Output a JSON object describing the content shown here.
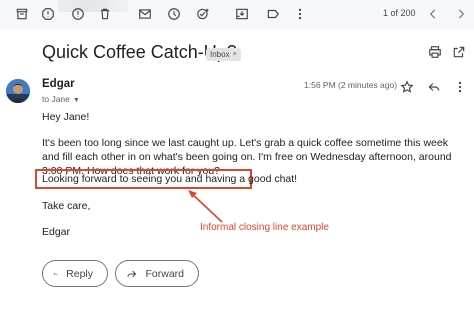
{
  "toolbar": {
    "counter": "1 of 200",
    "icons": [
      "archive-icon",
      "report-spam-icon",
      "delete-icon",
      "mark-unread-icon",
      "snooze-icon",
      "add-task-icon",
      "move-to-icon",
      "label-icon",
      "more-vert-icon",
      "newer-icon",
      "older-icon"
    ]
  },
  "email": {
    "subject": "Quick Coffee Catch-Up?",
    "label_badge": "Inbox",
    "label_remove": "×",
    "sender": "Edgar",
    "to_line": "to Jane",
    "timestamp": "1:56 PM (2 minutes ago)",
    "greeting": "Hey Jane!",
    "paragraph": "It's been too long since we last caught up. Let's grab a quick coffee sometime this week and fill each other in on what's been going on. I'm free on Wednesday afternoon, around 3:00 PM. How does that work for you?",
    "closing_line": "Looking forward to seeing you and having a good chat!",
    "sign_off": "Take care,",
    "signature": "Edgar"
  },
  "annotation": {
    "label": "Informal closing line example",
    "color": "#e0462f"
  },
  "actions": {
    "reply_label": "Reply",
    "forward_label": "Forward"
  }
}
